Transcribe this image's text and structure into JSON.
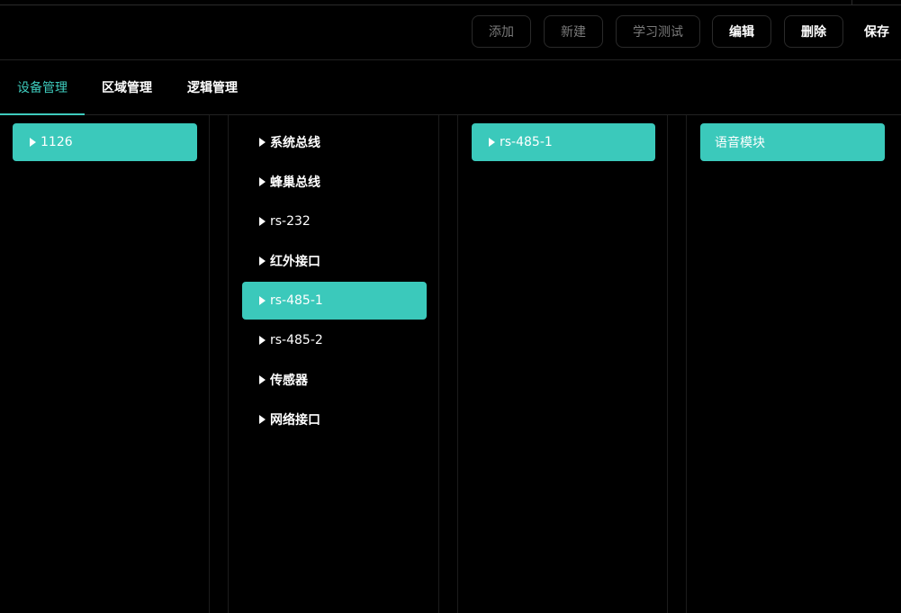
{
  "toolbar": {
    "buttons": [
      {
        "label": "添加",
        "state": "disabled"
      },
      {
        "label": "新建",
        "state": "disabled"
      },
      {
        "label": "学习测试",
        "state": "disabled"
      },
      {
        "label": "编辑",
        "state": "active"
      },
      {
        "label": "删除",
        "state": "active"
      },
      {
        "label": "保存",
        "state": "plain"
      }
    ]
  },
  "tabs": [
    {
      "label": "设备管理",
      "selected": true
    },
    {
      "label": "区域管理",
      "selected": false
    },
    {
      "label": "逻辑管理",
      "selected": false
    }
  ],
  "columns": {
    "col1": [
      {
        "label": "1126",
        "selected": true,
        "icon": "triangle-right-icon"
      }
    ],
    "col2": [
      {
        "label": "系统总线",
        "selected": false,
        "icon": "triangle-right-icon"
      },
      {
        "label": "蜂巢总线",
        "selected": false,
        "icon": "triangle-right-icon"
      },
      {
        "label": "rs-232",
        "selected": false,
        "icon": "triangle-right-icon"
      },
      {
        "label": "红外接口",
        "selected": false,
        "icon": "triangle-right-icon"
      },
      {
        "label": "rs-485-1",
        "selected": true,
        "icon": "triangle-right-icon"
      },
      {
        "label": "rs-485-2",
        "selected": false,
        "icon": "triangle-right-icon"
      },
      {
        "label": "传感器",
        "selected": false,
        "icon": "triangle-right-icon"
      },
      {
        "label": "网络接口",
        "selected": false,
        "icon": "triangle-right-icon"
      }
    ],
    "col3": [
      {
        "label": "rs-485-1",
        "selected": true,
        "icon": "triangle-right-icon"
      }
    ],
    "col4": [
      {
        "label": "语音模块",
        "selected": true
      }
    ]
  },
  "colors": {
    "accent": "#3bc9bb",
    "background": "#000000",
    "disabled_text": "#7a7a7a"
  }
}
